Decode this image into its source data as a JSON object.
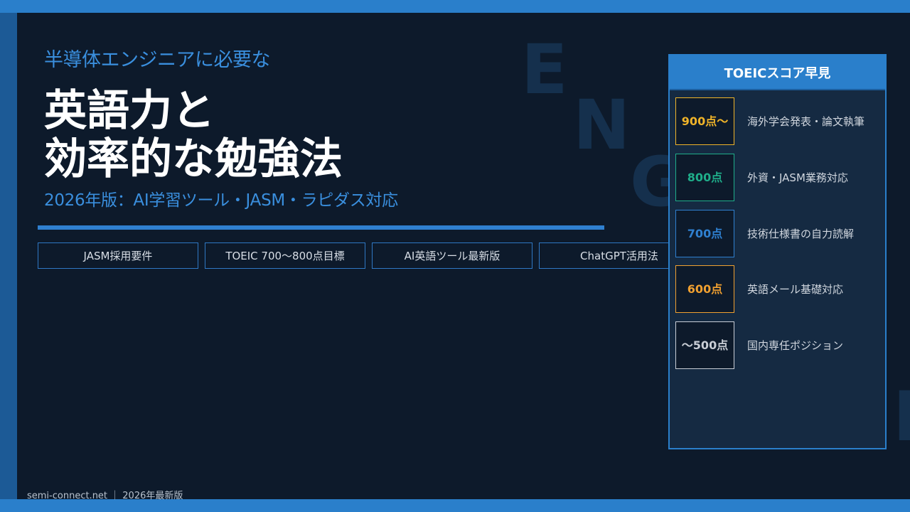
{
  "header": {
    "subtitle": "半導体エンジニアに必要な",
    "title_line1": "英語力と",
    "title_line2": "効率的な勉強法",
    "edition": "2026年版：AI学習ツール・JASM・ラピダス対応"
  },
  "watermark": {
    "letters": [
      "E",
      "N",
      "G",
      "H"
    ]
  },
  "tags": [
    "JASM採用要件",
    "TOEIC 700〜800点目標",
    "AI英語ツール最新版",
    "ChatGPT活用法"
  ],
  "panel": {
    "title": "TOEICスコア早見",
    "rows": [
      {
        "score": "900点〜",
        "desc": "海外学会発表・論文執筆",
        "color": "#f0b429"
      },
      {
        "score": "800点",
        "desc": "外資・JASM業務対応",
        "color": "#1fae8a"
      },
      {
        "score": "700点",
        "desc": "技術仕様書の自力読解",
        "color": "#2f80d0"
      },
      {
        "score": "600点",
        "desc": "英語メール基礎対応",
        "color": "#f0a030"
      },
      {
        "score": "〜500点",
        "desc": "国内専任ポジション",
        "color": "#c9ced6"
      }
    ]
  },
  "footer": {
    "text": "semi-connect.net ｜ 2026年最新版"
  },
  "colors": {
    "accent": "#2a7fcb",
    "background": "#0d1a2b",
    "panel": "#152a42"
  }
}
